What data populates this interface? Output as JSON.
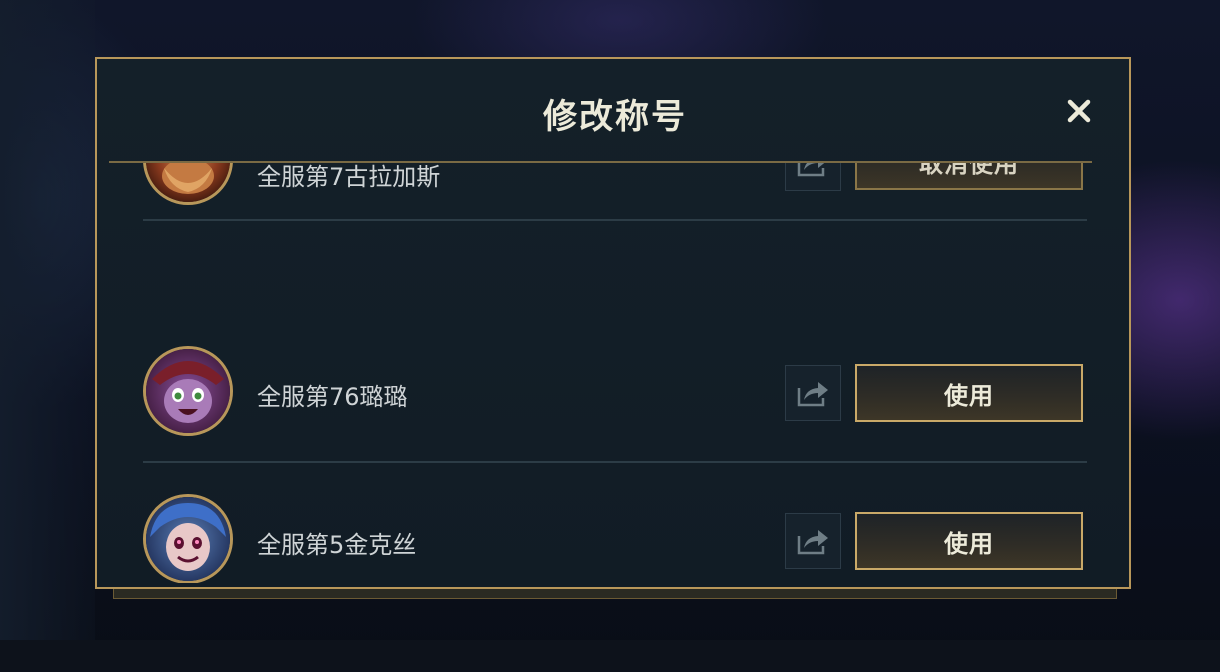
{
  "dialog": {
    "title": "修改称号",
    "close_icon": "close-icon"
  },
  "titles": [
    {
      "name": "全服第7古拉加斯",
      "avatar_icon": "gragas-avatar",
      "action_label": "取消使用",
      "equipped": true
    },
    {
      "name": "全服第76璐璐",
      "avatar_icon": "lulu-avatar",
      "action_label": "使用",
      "equipped": false
    },
    {
      "name": "全服第5金克丝",
      "avatar_icon": "jinx-avatar",
      "action_label": "使用",
      "equipped": false
    }
  ],
  "colors": {
    "gold_border": "#b8975a",
    "panel_bg": "#142029",
    "text": "#cfd4d6"
  }
}
